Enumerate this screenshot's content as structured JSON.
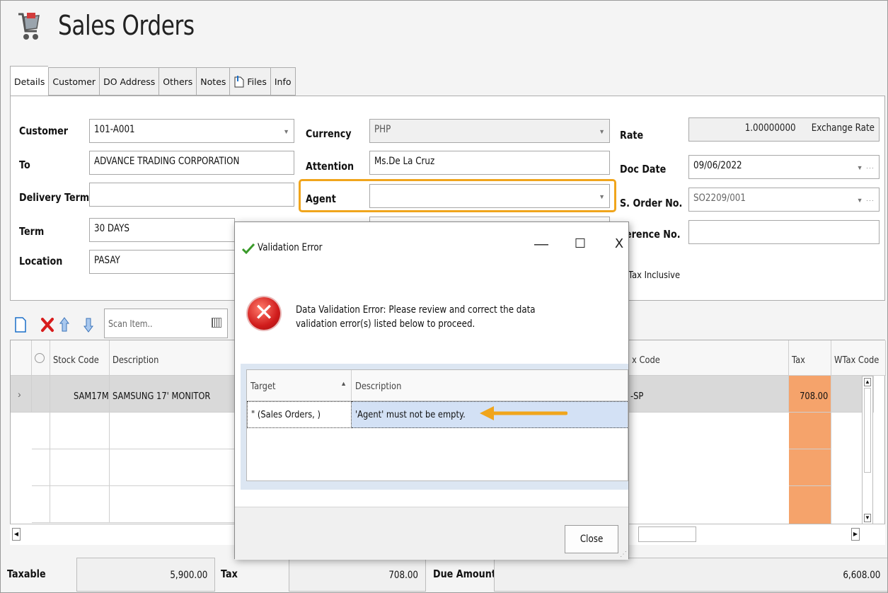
{
  "app": {
    "title": "Sales Orders"
  },
  "tabs": [
    {
      "label": "Details",
      "active": true
    },
    {
      "label": "Customer"
    },
    {
      "label": "DO Address"
    },
    {
      "label": "Others"
    },
    {
      "label": "Notes"
    },
    {
      "label": "Files",
      "icon": "attach-file-icon"
    },
    {
      "label": "Info"
    }
  ],
  "form": {
    "customer_label": "Customer",
    "customer_value": "101-A001",
    "to_label": "To",
    "to_value": "ADVANCE TRADING CORPORATION",
    "delivery_term_label": "Delivery Term",
    "delivery_term_value": "",
    "term_label": "Term",
    "term_value": "30 DAYS",
    "location_label": "Location",
    "location_value": "PASAY",
    "currency_label": "Currency",
    "currency_value": "PHP",
    "attention_label": "Attention",
    "attention_value": "Ms.De La Cruz",
    "agent_label": "Agent",
    "agent_value": "",
    "rate_label": "Rate",
    "rate_value": "1.00000000",
    "exchange_rate_label": "Exchange Rate",
    "doc_date_label": "Doc Date",
    "doc_date_value": "09/06/2022",
    "so_no_label": "S. Order No.",
    "so_no_value": "SO2209/001",
    "reference_label": "erence No.",
    "reference_value": "",
    "tax_inclusive_label": "Tax Inclusive"
  },
  "toolbar": {
    "scan_placeholder": "Scan Item.."
  },
  "grid": {
    "headers": [
      "Stock Code",
      "Description",
      "x Code",
      "Tax",
      "WTax Code"
    ],
    "rows": [
      {
        "stock_code": "SAM17MNT",
        "description": "SAMSUNG 17' MONITOR",
        "tax_code": "-SP",
        "tax": "708.00"
      }
    ]
  },
  "totals": {
    "taxable_label": "Taxable",
    "taxable_value": "5,900.00",
    "tax_label": "Tax",
    "tax_value": "708.00",
    "due_label": "Due Amount",
    "due_value": "6,608.00"
  },
  "dialog": {
    "title": "Validation Error",
    "message": "Data Validation Error: Please review and correct the data validation error(s) listed below to proceed.",
    "headers": [
      "Target",
      "Description"
    ],
    "rows": [
      {
        "target": "\" (Sales Orders, )",
        "description": "'Agent' must not be empty."
      }
    ],
    "close_label": "Close",
    "min_glyph": "—",
    "max_glyph": "☐",
    "close_glyph": "X"
  },
  "colors": {
    "highlight": "#f0a51c",
    "tax_cell": "#f5a36b",
    "error_red": "#d01c1c"
  }
}
